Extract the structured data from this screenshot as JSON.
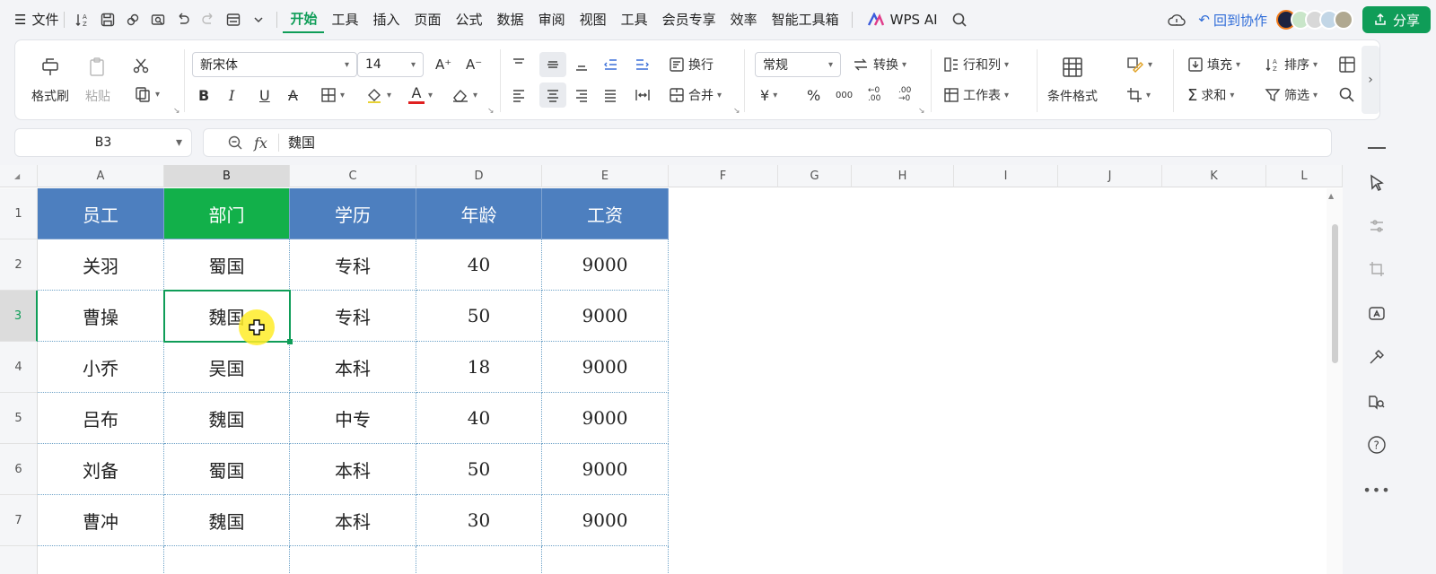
{
  "menubar": {
    "file_label": "文件",
    "tabs": [
      "开始",
      "工具",
      "插入",
      "页面",
      "公式",
      "数据",
      "审阅",
      "视图",
      "工具",
      "会员专享",
      "效率",
      "智能工具箱"
    ],
    "wps_ai_label": "WPS AI",
    "back_collab_label": "回到协作",
    "share_label": "分享"
  },
  "ribbon": {
    "format_painter": "格式刷",
    "paste": "粘贴",
    "font_name": "新宋体",
    "font_size": "14",
    "wrap_text": "换行",
    "merge": "合并",
    "number_format": "常规",
    "convert": "转换",
    "row_col": "行和列",
    "worksheet": "工作表",
    "cond_format": "条件格式",
    "fill": "填充",
    "sort": "排序",
    "sum": "求和",
    "filter": "筛选",
    "currency_symbol": "¥",
    "percent_symbol": "%",
    "thousands_symbol": "000",
    "dec_dec_symbol": "←0 .00",
    "dec_inc_symbol": ".00 →0",
    "bold": "B",
    "italic": "I",
    "underline": "U",
    "strike": "A",
    "font_color_glyph": "A",
    "font_color": "#e02020",
    "grow_font": "A⁺",
    "shrink_font": "A⁻"
  },
  "formula_bar": {
    "cell_ref": "B3",
    "fx_label": "fx",
    "value": "魏国"
  },
  "sheet": {
    "columns": [
      "A",
      "B",
      "C",
      "D",
      "E",
      "F",
      "G",
      "H",
      "I",
      "J",
      "K",
      "L"
    ],
    "rows": [
      "1",
      "2",
      "3",
      "4",
      "5",
      "6",
      "7"
    ],
    "header": [
      "员工",
      "部门",
      "学历",
      "年龄",
      "工资"
    ],
    "data": [
      [
        "关羽",
        "蜀国",
        "专科",
        "40",
        "9000"
      ],
      [
        "曹操",
        "魏国",
        "专科",
        "50",
        "9000"
      ],
      [
        "小乔",
        "吴国",
        "本科",
        "18",
        "9000"
      ],
      [
        "吕布",
        "魏国",
        "中专",
        "40",
        "9000"
      ],
      [
        "刘备",
        "蜀国",
        "本科",
        "50",
        "9000"
      ],
      [
        "曹冲",
        "魏国",
        "本科",
        "30",
        "9000"
      ]
    ],
    "selected_cell": "B3",
    "header_color": "#4d7fbf",
    "selected_header_color": "#12b04a"
  }
}
